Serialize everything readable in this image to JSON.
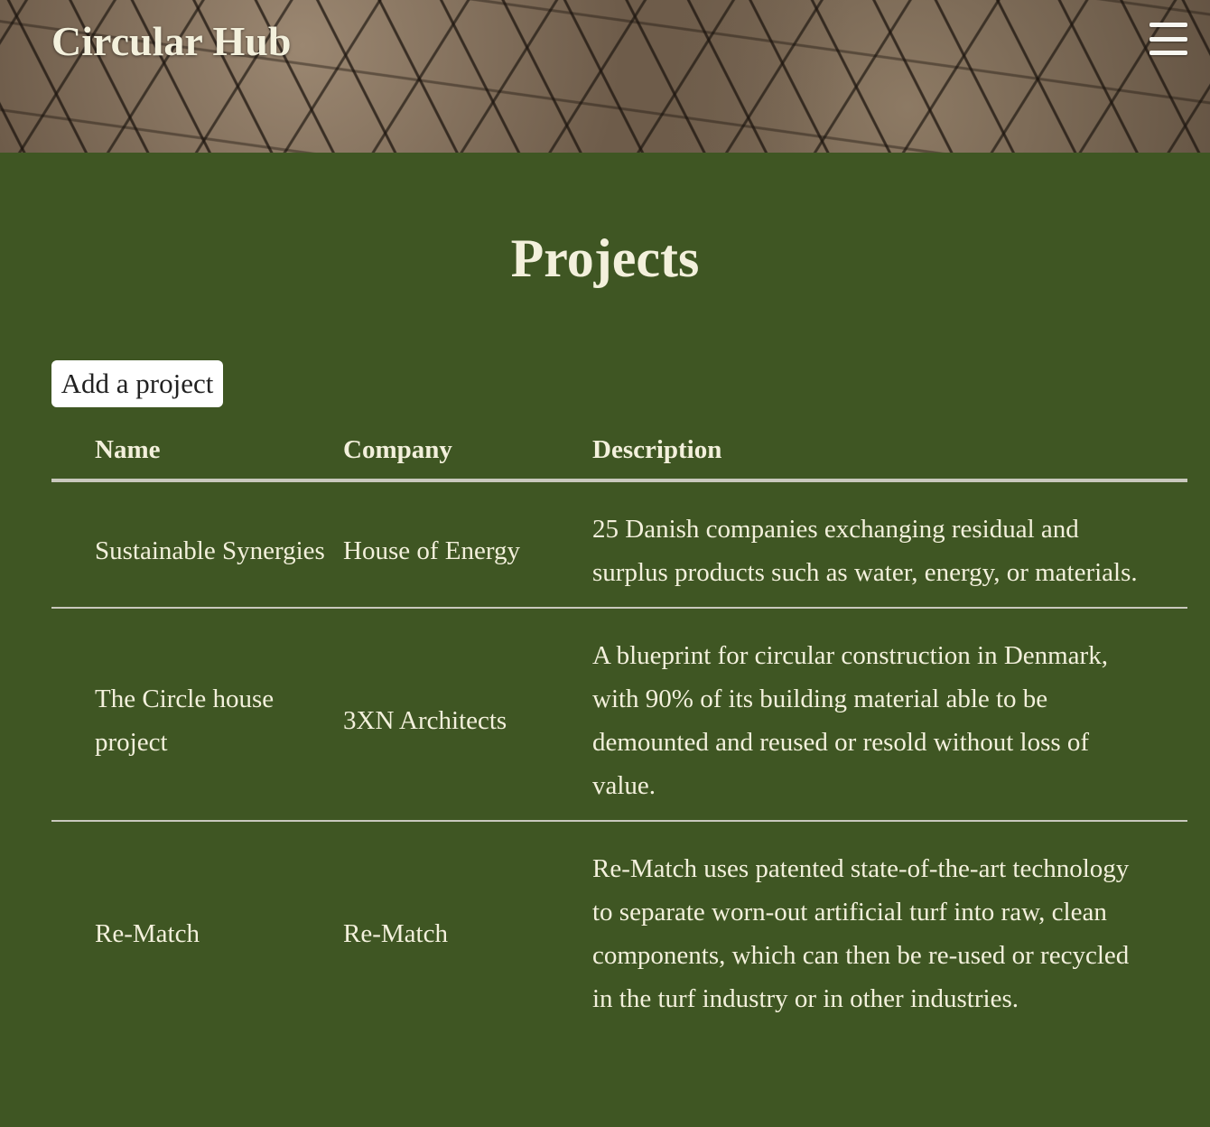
{
  "header": {
    "site_title": "Circular Hub",
    "menu_icon": "hamburger-menu-icon"
  },
  "main": {
    "page_title": "Projects",
    "add_button_label": "Add a project",
    "table": {
      "columns": [
        "Name",
        "Company",
        "Description"
      ],
      "rows": [
        {
          "name": "Sustainable Synergies",
          "company": "House of Energy",
          "description": "25 Danish companies exchanging residual and surplus products such as water, energy, or materials."
        },
        {
          "name": "The Circle house project",
          "company": "3XN Architects",
          "description": "A blueprint for circular construction in Denmark, with 90% of its building material able to be demounted and reused or resold without loss of value."
        },
        {
          "name": "Re-Match",
          "company": "Re-Match",
          "description": "Re-Match uses patented state-of-the-art technology to separate worn-out artificial turf into raw, clean components, which can then be re-used or recycled in the turf industry or in other industries."
        }
      ]
    }
  },
  "colors": {
    "background": "#3f5623",
    "text": "#f3f0dc",
    "button_bg": "#ffffff"
  }
}
